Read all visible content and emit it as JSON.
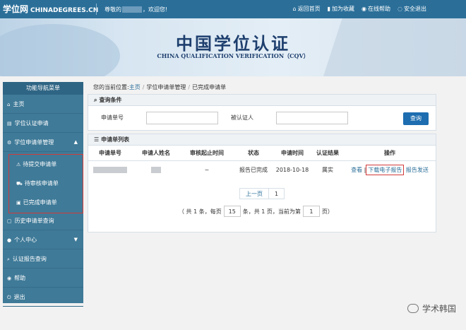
{
  "topbar": {
    "logo_cn": "学位网",
    "logo_domain": "CHINADEGREES.CN",
    "greeting_prefix": "尊敬的",
    "greeting_suffix": "，欢迎您!",
    "links": [
      {
        "label": "返回首页",
        "icon": "home-icon",
        "glyph": "⌂"
      },
      {
        "label": "加为收藏",
        "icon": "bookmark-icon",
        "glyph": "▮"
      },
      {
        "label": "在线帮助",
        "icon": "help-icon",
        "glyph": "◉"
      },
      {
        "label": "安全退出",
        "icon": "logout-icon",
        "glyph": "◌"
      }
    ]
  },
  "banner": {
    "title_cn": "中国学位认证",
    "title_en": "CHINA QUALIFICATION VERIFICATION（CQV）"
  },
  "sidebar": {
    "header": "功能导航菜单",
    "items": [
      {
        "label": "主页",
        "icon": "home-icon",
        "glyph": "⌂"
      },
      {
        "label": "学位认证申请",
        "icon": "document-icon",
        "glyph": "▤"
      },
      {
        "label": "学位申请单管理",
        "icon": "settings-icon",
        "glyph": "⚙",
        "chevron": "▲"
      }
    ],
    "subitems": [
      {
        "label": "待提交申请单",
        "icon": "warning-icon",
        "glyph": "⚠"
      },
      {
        "label": "待审核申请单",
        "icon": "cart-icon",
        "glyph": "⛟"
      },
      {
        "label": "已完成申请单",
        "icon": "briefcase-icon",
        "glyph": "▣"
      }
    ],
    "items_after": [
      {
        "label": "历史申请单查询",
        "icon": "history-icon",
        "glyph": "▢"
      },
      {
        "label": "个人中心",
        "icon": "user-icon",
        "glyph": "●",
        "chevron": "▼"
      },
      {
        "label": "认证报告查询",
        "icon": "search-icon",
        "glyph": "⌕"
      },
      {
        "label": "帮助",
        "icon": "help-icon",
        "glyph": "◉"
      },
      {
        "label": "退出",
        "icon": "power-icon",
        "glyph": "⏻"
      }
    ]
  },
  "breadcrumb": {
    "prefix": "您的当前位置:",
    "home": "主页",
    "level2": "学位申请单管理",
    "level3": "已完成申请单",
    "separator": "/"
  },
  "query": {
    "title": "查询条件",
    "title_glyph": "⌕",
    "label_app_no": "申请单号",
    "label_person": "被认证人",
    "app_no_value": "",
    "person_value": "",
    "button": "查询"
  },
  "list": {
    "title": "申请单列表",
    "title_glyph": "☰",
    "columns": [
      "申请单号",
      "申请人姓名",
      "审核起止时间",
      "状态",
      "申请时间",
      "认证结果",
      "操作"
    ],
    "rows": [
      {
        "period": "~",
        "status": "报告已完成",
        "apply_date": "2018-10-18",
        "result": "属实",
        "op_view": "查看",
        "op_sep": "|",
        "op_download": "下载电子报告",
        "op_send": "报告发送"
      }
    ]
  },
  "pagination": {
    "prev": "上一页",
    "current": "1",
    "info_1": "（ 共 1 条，每页",
    "per_page": "15",
    "info_2": "条，共 1 页，当前为第",
    "page_no": "1",
    "info_3": "页）"
  },
  "watermark": {
    "text": "学术韩国"
  }
}
